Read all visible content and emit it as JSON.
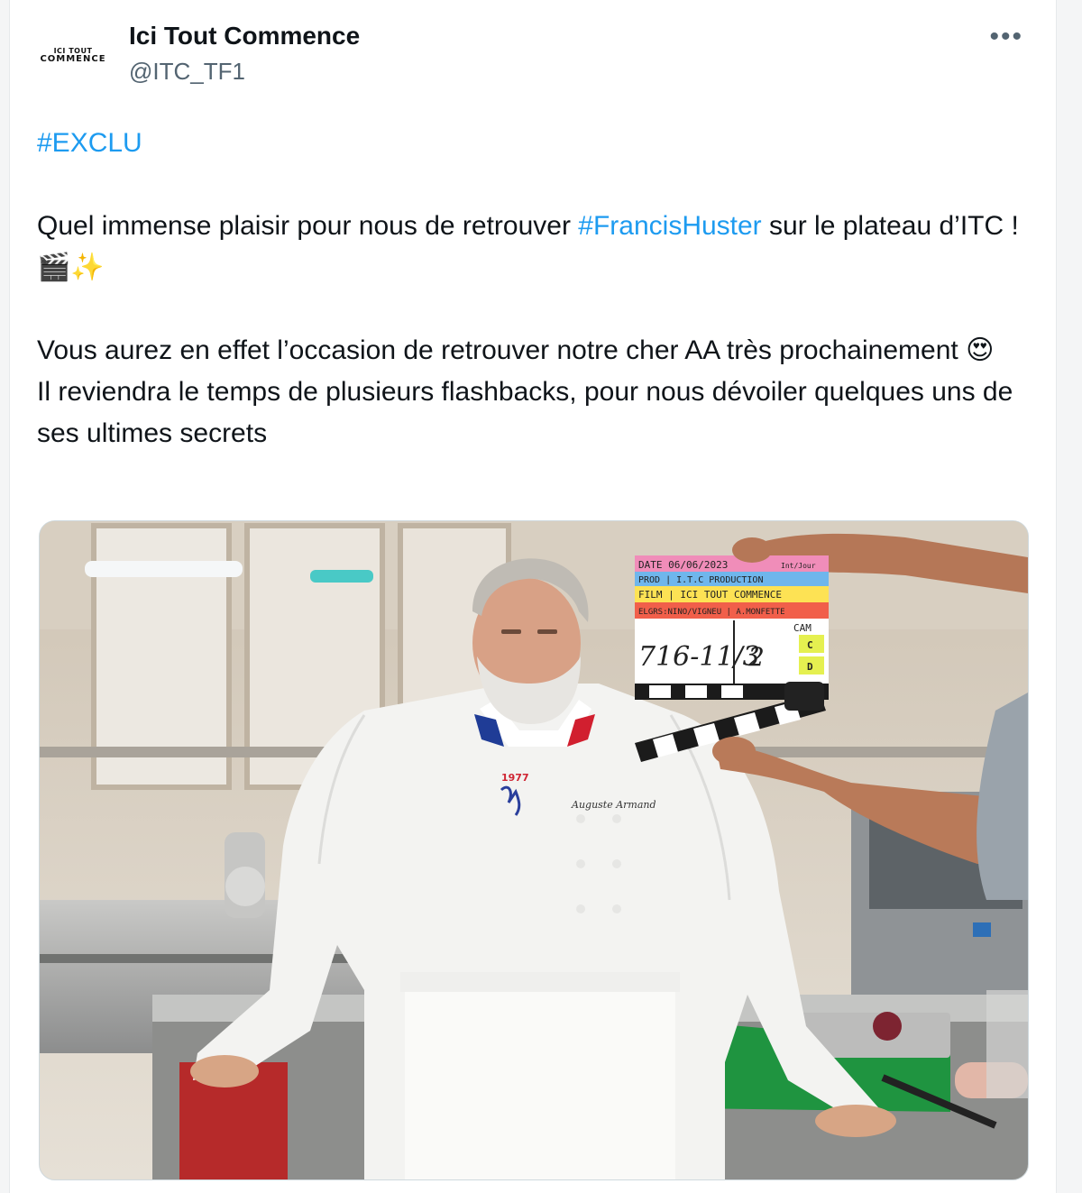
{
  "author": {
    "avatar_text_line1": "ICI TOUT",
    "avatar_text_line2": "COMMENCE",
    "name": "Ici Tout Commence",
    "handle": "@ITC_TF1"
  },
  "menu_icon": "more-horizontal-icon",
  "tweet": {
    "hashtag_1": "#EXCLU",
    "line_1_a": "Quel immense plaisir pour nous de retrouver ",
    "hashtag_2": "#FrancisHuster",
    "line_1_b": " sur le plateau d’ITC ! ",
    "emoji_1": "🎬✨",
    "line_2": "Vous aurez en effet l’occasion de retrouver notre cher AA très prochainement ",
    "emoji_2": "😍",
    "line_3": "Il reviendra le temps de plusieurs flashbacks, pour nous dévoiler quelques uns de ses ultimes secrets"
  },
  "photo": {
    "clap_date": "DATE 06/06/2023",
    "clap_int": "Int/Jour",
    "clap_prod": "PROD | I.T.C PRODUCTION",
    "clap_film": "FILM | ICI TOUT COMMENCE",
    "clap_crew": "ELGRS:NINO/VIGNEU | A.MONFETTE",
    "clap_scene": "716-11/3",
    "clap_take": "2",
    "clap_cam": "CAM",
    "clap_c": "C",
    "clap_d": "D",
    "jacket_year": "1977",
    "jacket_name": "Auguste Armand"
  }
}
